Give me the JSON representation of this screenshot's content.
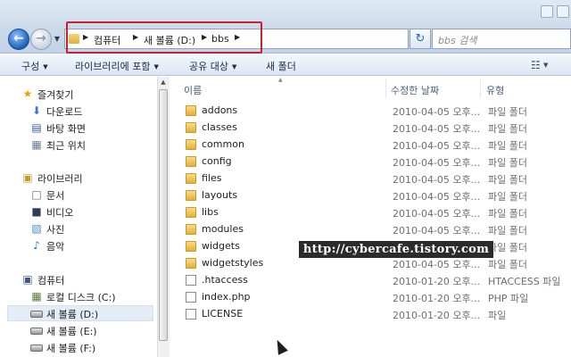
{
  "window": {
    "address": {
      "segments": [
        "컴퓨터",
        "새 볼륨 (D:)",
        "bbs"
      ]
    },
    "search_placeholder": "bbs 검색"
  },
  "commandbar": {
    "organize": "구성",
    "include_library": "라이브러리에 포함",
    "share": "공유 대상",
    "new_folder": "새 폴더"
  },
  "navpane": {
    "favorites": "즐겨찾기",
    "favorites_items": [
      "다운로드",
      "바탕 화면",
      "최근 위치"
    ],
    "libraries": "라이브러리",
    "libraries_items": [
      "문서",
      "비디오",
      "사진",
      "음악"
    ],
    "computer": "컴퓨터",
    "computer_items": [
      "로컬 디스크 (C:)",
      "새 볼륨 (D:)",
      "새 볼륨 (E:)",
      "새 볼륨 (F:)"
    ]
  },
  "columns": {
    "name": "이름",
    "date": "수정한 날짜",
    "type": "유형"
  },
  "files": [
    {
      "name": "addons",
      "date": "2010-04-05 오후...",
      "type": "파일 폴더",
      "kind": "folder"
    },
    {
      "name": "classes",
      "date": "2010-04-05 오후...",
      "type": "파일 폴더",
      "kind": "folder"
    },
    {
      "name": "common",
      "date": "2010-04-05 오후...",
      "type": "파일 폴더",
      "kind": "folder"
    },
    {
      "name": "config",
      "date": "2010-04-05 오후...",
      "type": "파일 폴더",
      "kind": "folder"
    },
    {
      "name": "files",
      "date": "2010-04-05 오후...",
      "type": "파일 폴더",
      "kind": "folder"
    },
    {
      "name": "layouts",
      "date": "2010-04-05 오후...",
      "type": "파일 폴더",
      "kind": "folder"
    },
    {
      "name": "libs",
      "date": "2010-04-05 오후...",
      "type": "파일 폴더",
      "kind": "folder"
    },
    {
      "name": "modules",
      "date": "2010-04-05 오후...",
      "type": "파일 폴더",
      "kind": "folder"
    },
    {
      "name": "widgets",
      "date": "2010-04-05 오후...",
      "type": "파일 폴더",
      "kind": "folder"
    },
    {
      "name": "widgetstyles",
      "date": "2010-04-05 오후...",
      "type": "파일 폴더",
      "kind": "folder"
    },
    {
      "name": ".htaccess",
      "date": "2010-01-20 오후...",
      "type": "HTACCESS 파일",
      "kind": "file"
    },
    {
      "name": "index.php",
      "date": "2010-01-20 오후...",
      "type": "PHP 파일",
      "kind": "file"
    },
    {
      "name": "LICENSE",
      "date": "2010-01-20 오후...",
      "type": "파일",
      "kind": "file"
    }
  ],
  "watermark": "http://cybercafe.tistory.com",
  "colors": {
    "highlight_box": "#c8202c",
    "folder": "#e3b03c",
    "selection": "#e4ecf6"
  }
}
